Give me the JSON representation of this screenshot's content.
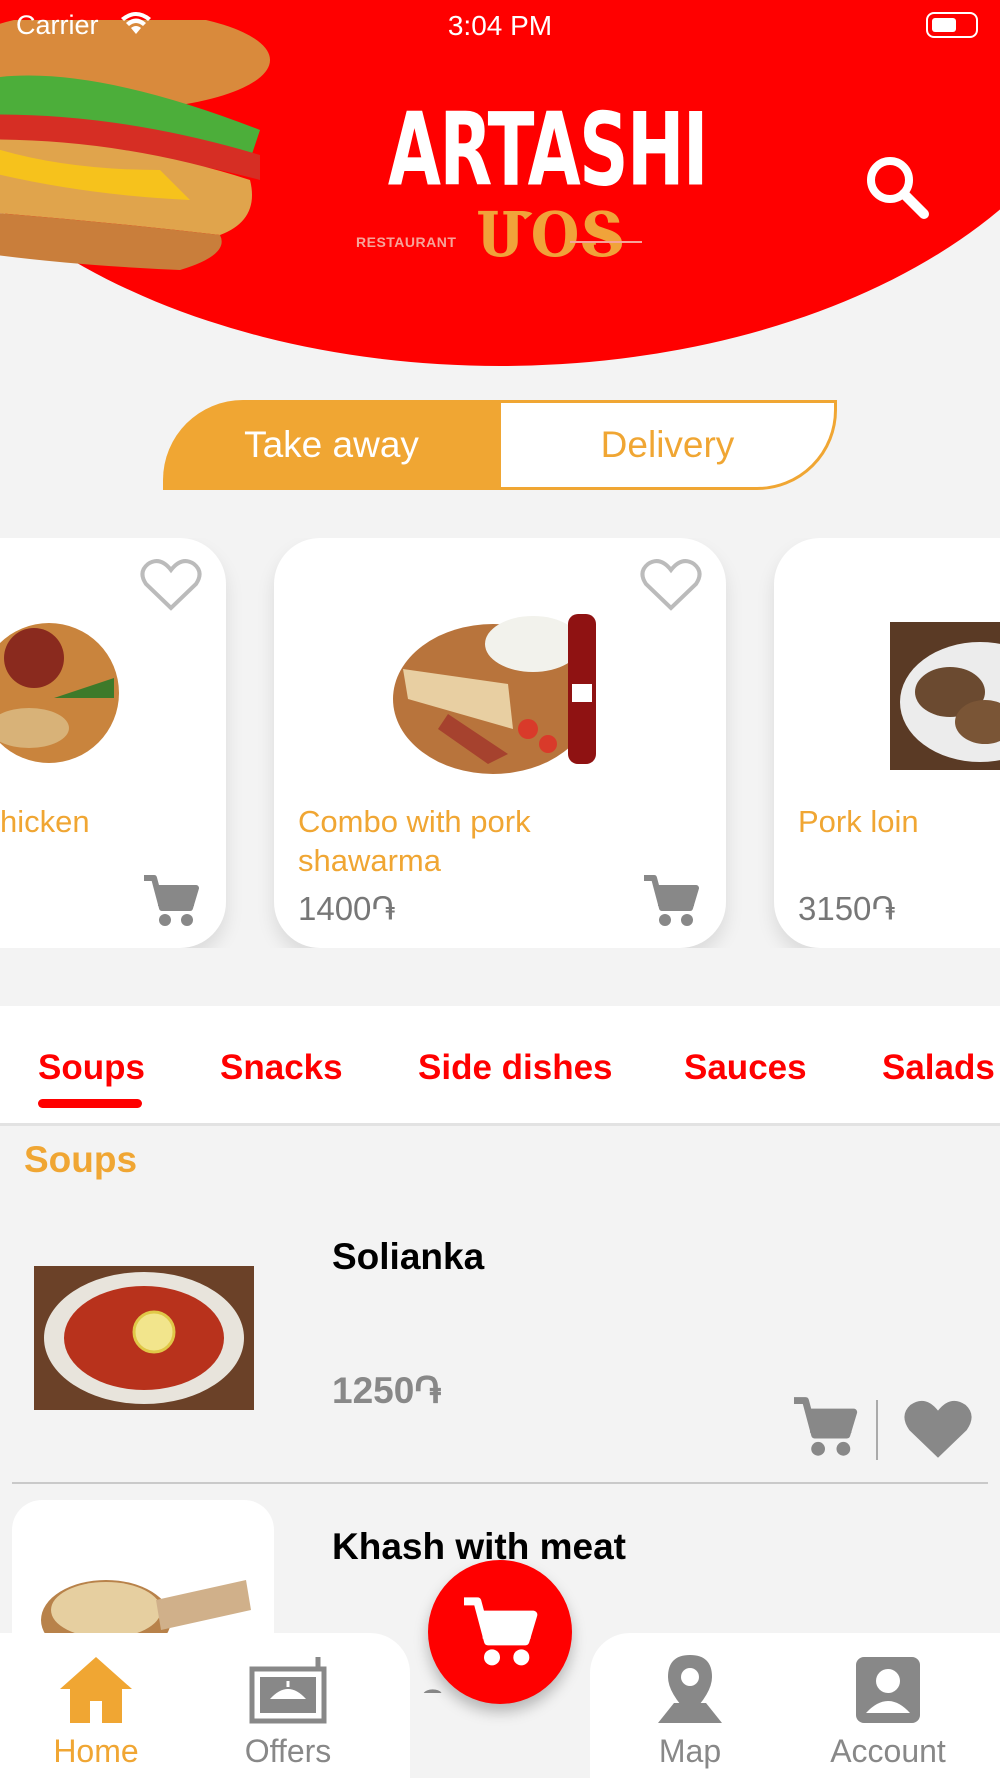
{
  "status_bar": {
    "carrier": "Carrier",
    "time": "3:04 PM"
  },
  "brand": {
    "name": "ARTASHI",
    "sub": "RESTAURANT",
    "mark": "ՄՕՏ"
  },
  "order_mode": {
    "take_away": "Take away",
    "delivery": "Delivery",
    "selected": "Take away"
  },
  "featured": [
    {
      "name": "hicken",
      "price": ""
    },
    {
      "name": "Combo with pork shawarma",
      "price": "1400֏"
    },
    {
      "name": "Pork loin",
      "price": "3150֏"
    }
  ],
  "categories": [
    {
      "label": "Soups",
      "active": true
    },
    {
      "label": "Snacks",
      "active": false
    },
    {
      "label": "Side dishes",
      "active": false
    },
    {
      "label": "Sauces",
      "active": false
    },
    {
      "label": "Salads",
      "active": false
    }
  ],
  "section": {
    "title": "Soups"
  },
  "items": [
    {
      "name": "Solianka",
      "price": "1250֏"
    },
    {
      "name": "Khash with meat",
      "price": "֏"
    }
  ],
  "bottom_nav": [
    {
      "label": "Home",
      "icon": "home-icon",
      "active": true
    },
    {
      "label": "Offers",
      "icon": "offers-icon",
      "active": false
    },
    {
      "label": "Map",
      "icon": "map-pin-icon",
      "active": false
    },
    {
      "label": "Account",
      "icon": "account-icon",
      "active": false
    }
  ],
  "colors": {
    "brand_red": "#ff0000",
    "accent_orange": "#f0a633",
    "grey": "#888888"
  }
}
